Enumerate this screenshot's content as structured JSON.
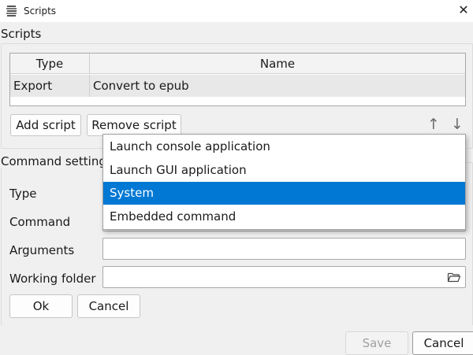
{
  "window": {
    "title": "Scripts",
    "close_icon": "close-icon"
  },
  "scripts_group": {
    "label": "Scripts",
    "table": {
      "columns": [
        "Type",
        "Name"
      ],
      "rows": [
        {
          "type": "Export",
          "name": "Convert to epub"
        }
      ]
    },
    "add_button": "Add script",
    "remove_button": "Remove script",
    "move_up_icon": "arrow-up-icon",
    "move_down_icon": "arrow-down-icon"
  },
  "command_settings": {
    "label": "Command settings",
    "type_label": "Type",
    "command_label": "Command",
    "arguments_label": "Arguments",
    "arguments_value": "",
    "working_folder_label": "Working folder",
    "working_folder_value": "",
    "folder_icon": "folder-open-icon",
    "ok_button": "Ok",
    "cancel_button": "Cancel"
  },
  "type_dropdown": {
    "options": [
      "Launch console application",
      "Launch GUI application",
      "System",
      "Embedded command"
    ],
    "selected_index": 2
  },
  "dialog_buttons": {
    "save": "Save",
    "cancel": "Cancel"
  },
  "colors": {
    "selection": "#0078d4",
    "window_bg": "#f0f0f0"
  }
}
